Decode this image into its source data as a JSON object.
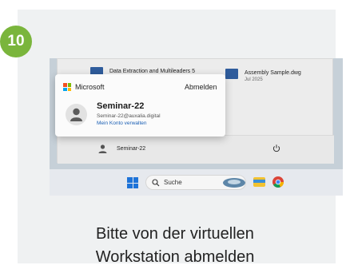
{
  "step": {
    "number": "10",
    "color": "#7ab53c"
  },
  "start_menu": {
    "recent": [
      {
        "name": "Data Extraction and Multileaders 5",
        "sub": ""
      },
      {
        "name": "Assembly Sample.dwg",
        "sub": "Jul 2025"
      }
    ],
    "footer_user": "Seminar-22",
    "power_icon": "power-icon"
  },
  "account_popup": {
    "brand": "Microsoft",
    "signout": "Abmelden",
    "name": "Seminar-22",
    "email": "Seminar-22@auxalia.digital",
    "manage": "Mein Konto verwalten"
  },
  "taskbar": {
    "search_placeholder": "Suche",
    "icons": [
      "windows-start-icon",
      "search-icon",
      "file-explorer-icon",
      "chrome-icon"
    ]
  },
  "caption": {
    "line1": "Bitte von der virtuellen",
    "line2": "Workstation abmelden"
  }
}
